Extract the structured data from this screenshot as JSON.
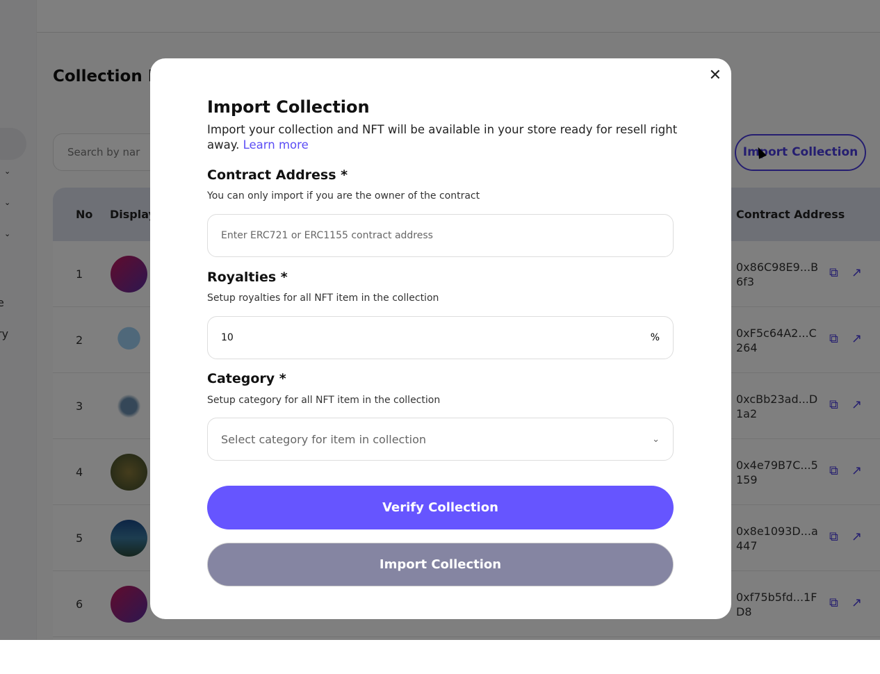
{
  "sidebar": {
    "partial_items": [
      "e",
      "ry"
    ]
  },
  "page": {
    "title": "Collection L",
    "search_placeholder": "Search by nar",
    "import_button": "Import Collection"
  },
  "table": {
    "headers": {
      "no": "No",
      "display": "Display",
      "contract": "Contract Address"
    },
    "rows": [
      {
        "no": "1",
        "address": "0x86C98E9...B6f3",
        "avatar": "nft-logo"
      },
      {
        "no": "2",
        "address": "0xF5c64A2...C264",
        "avatar": "rain-cloud"
      },
      {
        "no": "3",
        "address": "0xcBb23ad...D1a2",
        "avatar": "anime-figure"
      },
      {
        "no": "4",
        "address": "0x4e79B7C...5159",
        "avatar": "forest-stream"
      },
      {
        "no": "5",
        "address": "0x8e1093D...a447",
        "avatar": "lake"
      },
      {
        "no": "6",
        "address": "0xf75b5fd...1FD8",
        "avatar": "nft-logo"
      }
    ]
  },
  "modal": {
    "title": "Import Collection",
    "description": "Import your collection and NFT will be available in your store ready for resell right away.",
    "learn_more": "Learn more",
    "contract": {
      "label": "Contract Address *",
      "hint": "You can only import if you are the owner of the contract",
      "placeholder": "Enter ERC721 or ERC1155 contract address"
    },
    "royalties": {
      "label": "Royalties *",
      "hint": "Setup royalties for all NFT item in the collection",
      "value": "10",
      "suffix": "%"
    },
    "category": {
      "label": "Category *",
      "hint": "Setup category for all NFT item in the collection",
      "placeholder": "Select category for item in collection"
    },
    "verify_button": "Verify Collection",
    "import_button": "Import Collection"
  },
  "colors": {
    "primary": "#6655ff",
    "disabled": "#8585a2",
    "accent": "#4a3de0"
  }
}
